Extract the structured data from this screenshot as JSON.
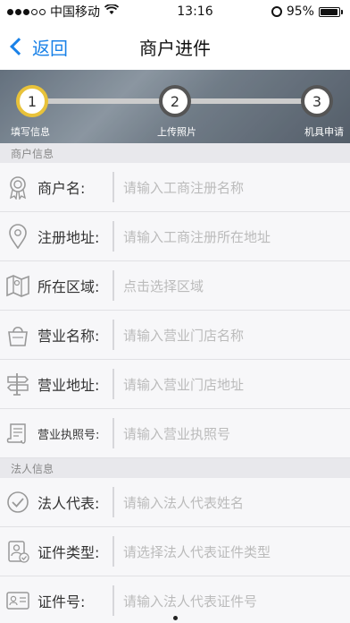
{
  "status": {
    "carrier": "中国移动",
    "time": "13:16",
    "battery_percent": "95%",
    "battery_level": 0.95
  },
  "nav": {
    "back_label": "返回",
    "title": "商户进件"
  },
  "steps": [
    {
      "number": "1",
      "label": "填写信息",
      "active": true
    },
    {
      "number": "2",
      "label": "上传照片",
      "active": false
    },
    {
      "number": "3",
      "label": "机具申请",
      "active": false
    }
  ],
  "sections": {
    "merchant": {
      "header": "商户信息",
      "rows": [
        {
          "icon": "badge-icon",
          "label": "商户名:",
          "placeholder": "请输入工商注册名称"
        },
        {
          "icon": "location-pin-icon",
          "label": "注册地址:",
          "placeholder": "请输入工商注册所在地址"
        },
        {
          "icon": "map-icon",
          "label": "所在区域:",
          "placeholder": "点击选择区域"
        },
        {
          "icon": "shopping-bag-icon",
          "label": "营业名称:",
          "placeholder": "请输入营业门店名称"
        },
        {
          "icon": "signpost-icon",
          "label": "营业地址:",
          "placeholder": "请输入营业门店地址"
        },
        {
          "icon": "license-scroll-icon",
          "label": "营业执照号:",
          "placeholder": "请输入营业执照号"
        }
      ]
    },
    "legal": {
      "header": "法人信息",
      "rows": [
        {
          "icon": "check-circle-icon",
          "label": "法人代表:",
          "placeholder": "请输入法人代表姓名"
        },
        {
          "icon": "id-badge-icon",
          "label": "证件类型:",
          "placeholder": "请选择法人代表证件类型"
        },
        {
          "icon": "id-card-icon",
          "label": "证件号:",
          "placeholder": "请输入法人代表证件号"
        }
      ]
    }
  }
}
